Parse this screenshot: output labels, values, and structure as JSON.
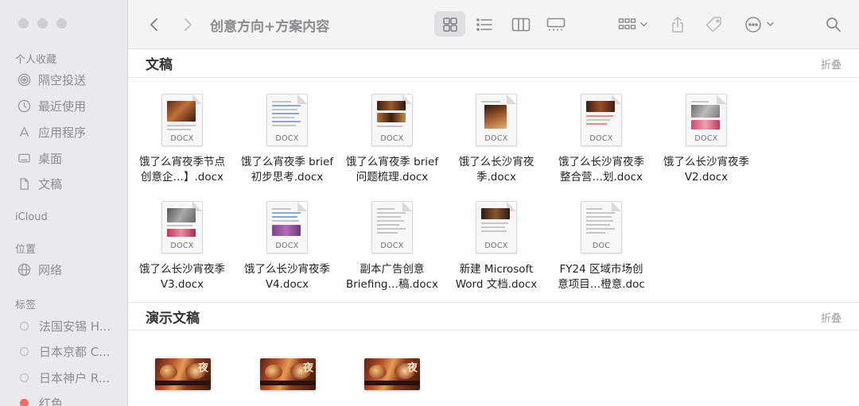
{
  "window": {
    "title": "创意方向+方案内容"
  },
  "sidebar": {
    "favorites_header": "个人收藏",
    "favorites": [
      {
        "label": "隔空投送",
        "icon": "airdrop-icon"
      },
      {
        "label": "最近使用",
        "icon": "clock-icon"
      },
      {
        "label": "应用程序",
        "icon": "applications-icon"
      },
      {
        "label": "桌面",
        "icon": "desktop-icon"
      },
      {
        "label": "文稿",
        "icon": "document-icon"
      }
    ],
    "icloud_header": "iCloud",
    "locations_header": "位置",
    "locations": [
      {
        "label": "网络",
        "icon": "globe-icon"
      }
    ],
    "tags_header": "标签",
    "tags": [
      {
        "label": "法国安锡 H...",
        "color": ""
      },
      {
        "label": "日本京都 C...",
        "color": ""
      },
      {
        "label": "日本神户 R...",
        "color": ""
      },
      {
        "label": "红色",
        "color": "#f26b6b"
      }
    ]
  },
  "toolbar": {
    "back_icon": "chevron-left-icon",
    "forward_icon": "chevron-right-icon",
    "views": [
      "icon-view-icon",
      "list-view-icon",
      "column-view-icon",
      "gallery-view-icon"
    ],
    "group_icon": "group-by-icon",
    "share_icon": "share-icon",
    "tag_icon": "tag-icon",
    "more_icon": "ellipsis-circle-icon",
    "search_icon": "search-icon"
  },
  "groups": [
    {
      "title": "文稿",
      "collapse_label": "折叠",
      "files": [
        {
          "line1": "饿了么宵夜季节点",
          "line2": "创意企…】.docx",
          "ext": "DOCX"
        },
        {
          "line1": "饿了么宵夜季 brief",
          "line2": "初步思考.docx",
          "ext": "DOCX"
        },
        {
          "line1": "饿了么宵夜季 brief",
          "line2": "问题梳理.docx",
          "ext": "DOCX"
        },
        {
          "line1": "饿了么长沙宵夜",
          "line2": "季.docx",
          "ext": "DOCX"
        },
        {
          "line1": "饿了么长沙宵夜季",
          "line2": "整合营…划.docx",
          "ext": "DOCX"
        },
        {
          "line1": "饿了么长沙宵夜季",
          "line2": "V2.docx",
          "ext": "DOCX"
        },
        {
          "line1": "饿了么长沙宵夜季",
          "line2": "V3.docx",
          "ext": "DOCX"
        },
        {
          "line1": "饿了么长沙宵夜季",
          "line2": "V4.docx",
          "ext": "DOCX"
        },
        {
          "line1": "副本广告创意",
          "line2": "Briefing…稿.docx",
          "ext": "DOCX"
        },
        {
          "line1": "新建 Microsoft",
          "line2": "Word 文档.docx",
          "ext": "DOCX"
        },
        {
          "line1": "FY24 区域市场创",
          "line2": "意项目…橙意.doc",
          "ext": "DOC"
        }
      ]
    },
    {
      "title": "演示文稿",
      "collapse_label": "折叠",
      "files": [
        {
          "thumb": "presentation-thumbnail"
        },
        {
          "thumb": "presentation-thumbnail"
        },
        {
          "thumb": "presentation-thumbnail"
        }
      ]
    }
  ]
}
